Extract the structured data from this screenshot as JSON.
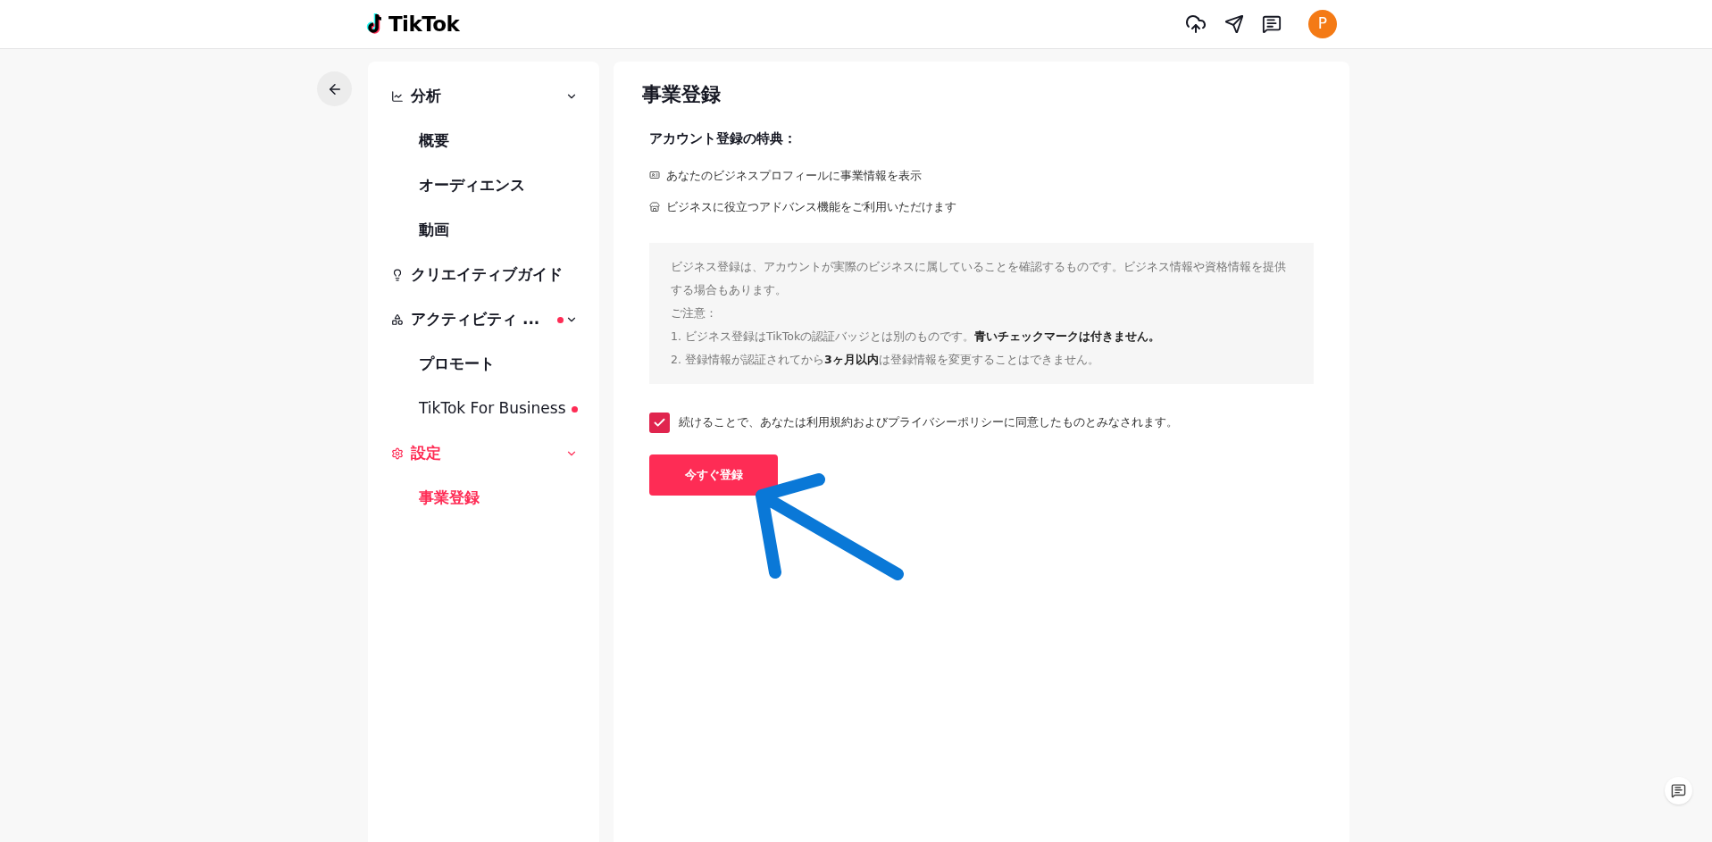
{
  "header": {
    "logo": "TikTok",
    "avatar": "P"
  },
  "sidebar": {
    "items": [
      {
        "label": "分析",
        "kind": "chart",
        "expanded": true,
        "selected": false,
        "dot": false,
        "children": [
          {
            "label": "概要",
            "selected": false,
            "dot": false
          },
          {
            "label": "オーディエンス",
            "selected": false,
            "dot": false
          },
          {
            "label": "動画",
            "selected": false,
            "dot": false
          }
        ]
      },
      {
        "label": "クリエイティブガイド",
        "kind": "bulb",
        "selected": false,
        "dot": false
      },
      {
        "label": "アクティビティ ...",
        "kind": "grid",
        "expanded": true,
        "selected": false,
        "dot": true,
        "children": [
          {
            "label": "プロモート",
            "selected": false,
            "dot": false
          },
          {
            "label": "TikTok For Business",
            "selected": false,
            "dot": true
          }
        ]
      },
      {
        "label": "設定",
        "kind": "gear",
        "expanded": true,
        "selected": true,
        "dot": false,
        "children": [
          {
            "label": "事業登録",
            "selected": true,
            "dot": false
          }
        ]
      }
    ]
  },
  "main": {
    "title": "事業登録",
    "benefits_title": "アカウント登録の特典：",
    "benefits": [
      {
        "kind": "profile",
        "text": "あなたのビジネスプロフィールに事業情報を表示"
      },
      {
        "kind": "store",
        "text": "ビジネスに役立つアドバンス機能をご利用いただけます"
      }
    ],
    "notice": [
      "ビジネス登録は、アカウントが実際のビジネスに属していることを確認するものです。ビジネス情報や資格情報を提供する場合もあります。",
      "ご注意：",
      "1. ビジネス登録はTikTokの認証バッジとは別のものです。**青いチェックマークは付きません。**",
      "2. 登録情報が認証されてから**3ヶ月以内**は登録情報を変更することはできません。"
    ],
    "agreement": {
      "checked": true,
      "text": "続けることで、あなたは利用規約およびプライバシーポリシーに同意したものとみなされます。"
    },
    "button": "今すぐ登録"
  }
}
